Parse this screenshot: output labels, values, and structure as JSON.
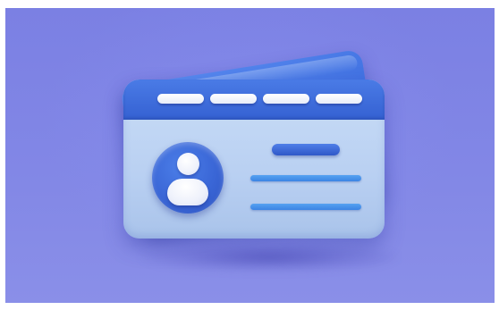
{
  "scene": {
    "background_top_color": "#7b80e3",
    "background_bottom_color": "#8a8fe8",
    "subject": {
      "card_fill_color": "#bfd4f3",
      "header_color": "#3d6adb",
      "back_card_color": "#4677e6",
      "avatar_color": "#3a66d6",
      "name_bar_color": "#3a64d4",
      "info_line_color": "#4a93ea",
      "header_pill_count": 4,
      "info_line_count": 2,
      "icons": [
        "id-card-icon",
        "user-avatar-icon"
      ]
    }
  }
}
